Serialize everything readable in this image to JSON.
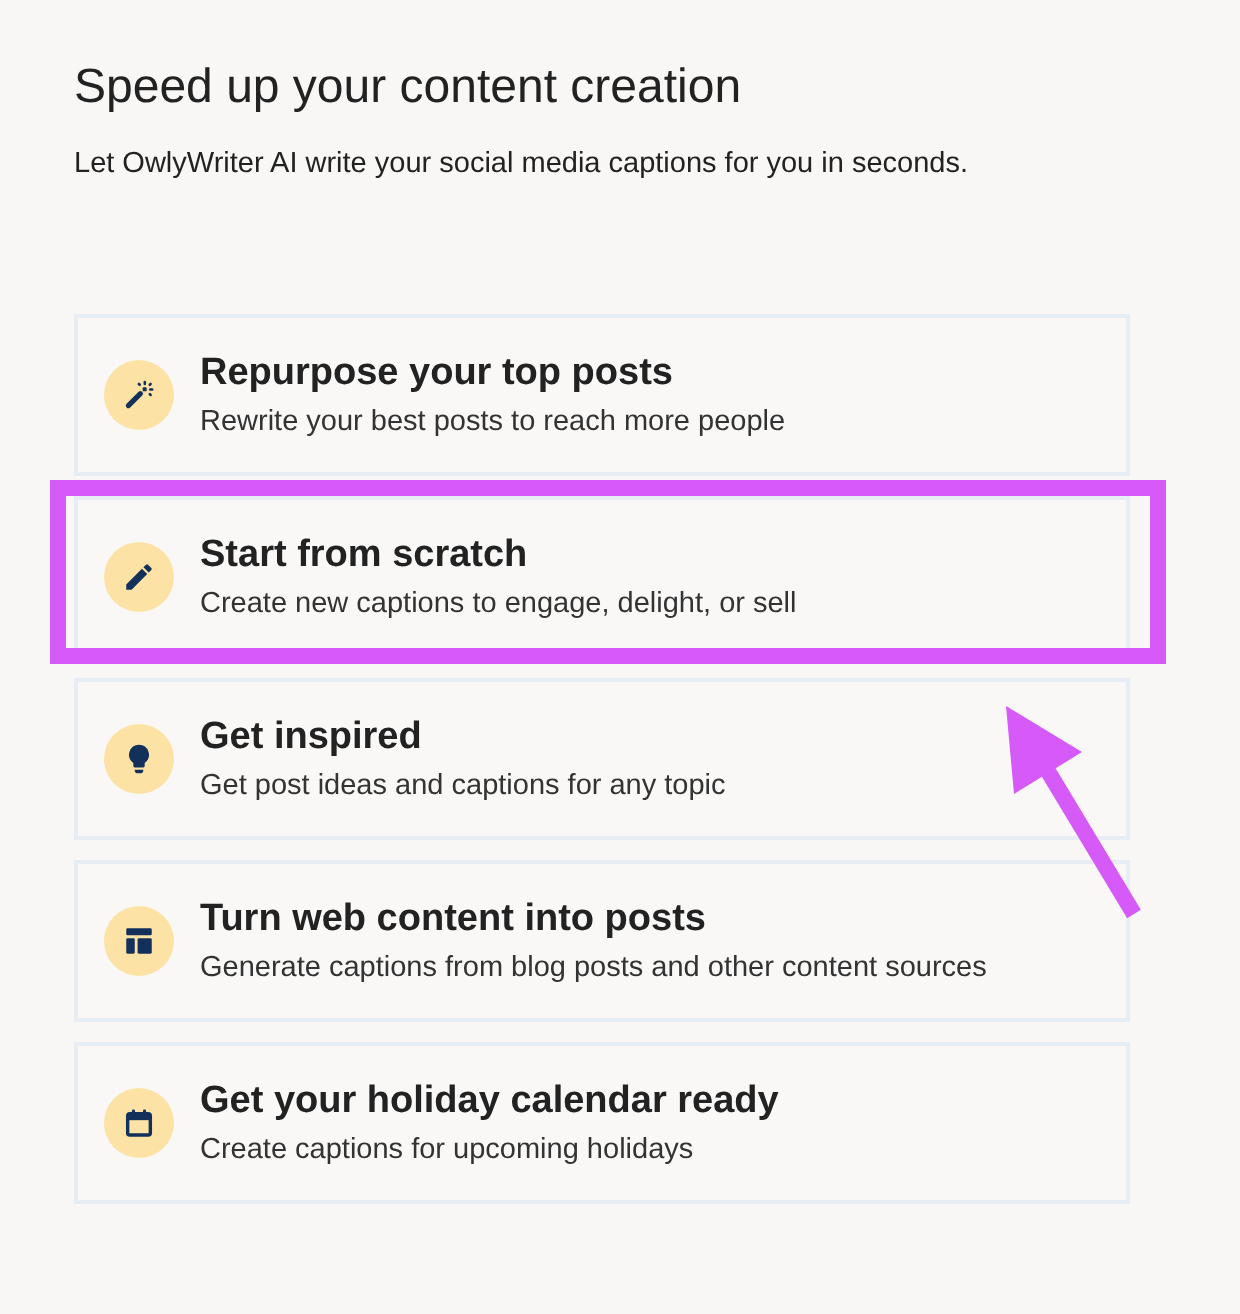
{
  "heading": "Speed up your content creation",
  "subtitle": "Let OwlyWriter AI write your social media captions for you in seconds.",
  "options": [
    {
      "title": "Repurpose your top posts",
      "description": "Rewrite your best posts to reach more people",
      "highlighted": false
    },
    {
      "title": "Start from scratch",
      "description": "Create new captions to engage, delight, or sell",
      "highlighted": true
    },
    {
      "title": "Get inspired",
      "description": "Get post ideas and captions for any topic",
      "highlighted": false
    },
    {
      "title": "Turn web content into posts",
      "description": "Generate captions from blog posts and other content sources",
      "highlighted": false
    },
    {
      "title": "Get your holiday calendar ready",
      "description": "Create captions for upcoming holidays",
      "highlighted": false
    }
  ]
}
